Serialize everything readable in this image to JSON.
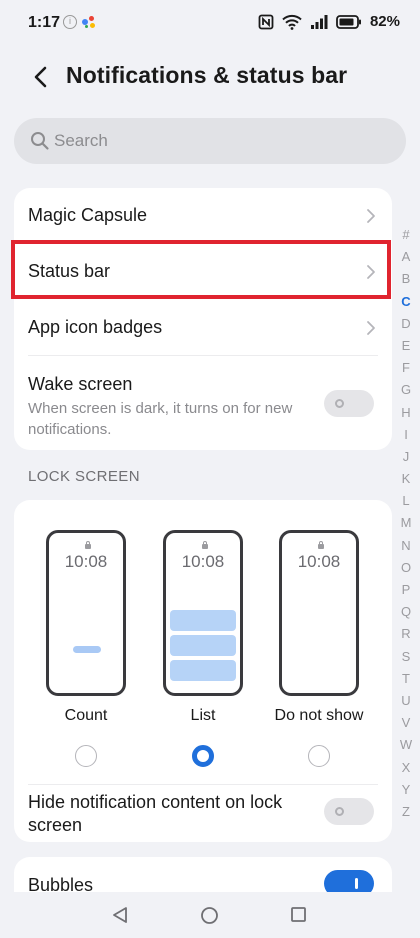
{
  "status_bar": {
    "time": "1:17",
    "battery": "82%"
  },
  "header": {
    "title": "Notifications & status bar"
  },
  "search": {
    "placeholder": "Search"
  },
  "main_settings": {
    "items": [
      {
        "label": "Magic Capsule"
      },
      {
        "label": "Status bar"
      },
      {
        "label": "App icon badges"
      }
    ],
    "wake_screen": {
      "label": "Wake screen",
      "description": "When screen is dark, it turns on for new notifications.",
      "enabled": false
    }
  },
  "lock_screen": {
    "section_title": "LOCK SCREEN",
    "preview_time": "10:08",
    "options": [
      {
        "label": "Count",
        "selected": false
      },
      {
        "label": "List",
        "selected": true
      },
      {
        "label": "Do not show",
        "selected": false
      }
    ],
    "hide_content": {
      "label": "Hide notification content on lock screen",
      "enabled": false
    }
  },
  "bubbles": {
    "label": "Bubbles",
    "enabled": true
  },
  "index_bar": {
    "letters": [
      "#",
      "A",
      "B",
      "C",
      "D",
      "E",
      "F",
      "G",
      "H",
      "I",
      "J",
      "K",
      "L",
      "M",
      "N",
      "O",
      "P",
      "Q",
      "R",
      "S",
      "T",
      "U",
      "V",
      "W",
      "X",
      "Y",
      "Z"
    ],
    "active": "C"
  },
  "colors": {
    "accent": "#1f6fdb",
    "highlight": "#e0242f",
    "background": "#f1f2f6"
  }
}
